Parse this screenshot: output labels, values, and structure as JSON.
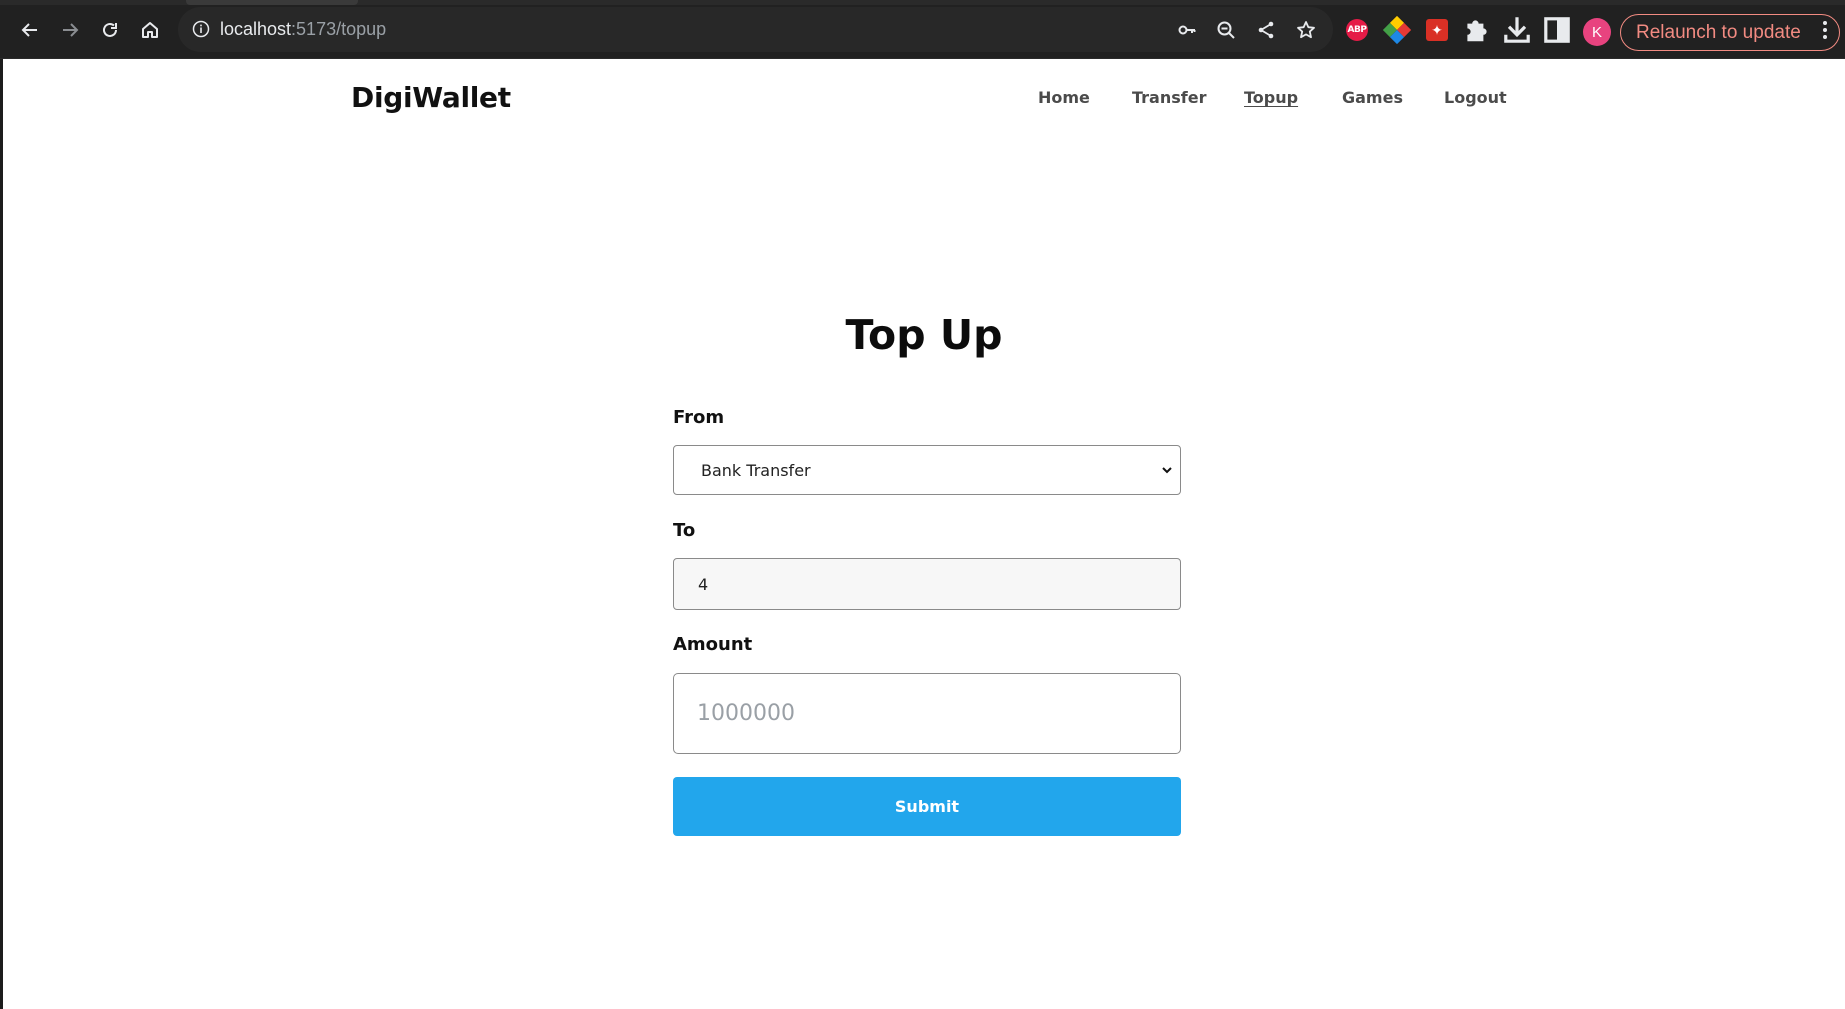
{
  "browser": {
    "url_host": "localhost",
    "url_path": ":5173/topup",
    "relaunch_label": "Relaunch to update",
    "profile_initial": "K",
    "abp_label": "ABP",
    "icons": [
      "back-icon",
      "forward-icon",
      "reload-icon",
      "home-icon",
      "info-icon",
      "key-icon",
      "zoom-out-icon",
      "share-icon",
      "star-icon",
      "adblock-icon",
      "color-extension-icon",
      "red-extension-icon",
      "puzzle-icon",
      "download-icon",
      "side-panel-icon",
      "kebab-menu-icon"
    ],
    "relaunch_color": "#f28b82",
    "avatar_color": "#e8437f"
  },
  "header": {
    "brand": "DigiWallet",
    "nav": [
      {
        "label": "Home",
        "active": false
      },
      {
        "label": "Transfer",
        "active": false
      },
      {
        "label": "Topup",
        "active": true
      },
      {
        "label": "Games",
        "active": false
      },
      {
        "label": "Logout",
        "active": false
      }
    ]
  },
  "main": {
    "title": "Top Up",
    "from_label": "From",
    "from_value": "Bank Transfer",
    "to_label": "To",
    "to_value": "4",
    "amount_label": "Amount",
    "amount_placeholder": "1000000",
    "submit_label": "Submit",
    "submit_color": "#22a6ec"
  }
}
